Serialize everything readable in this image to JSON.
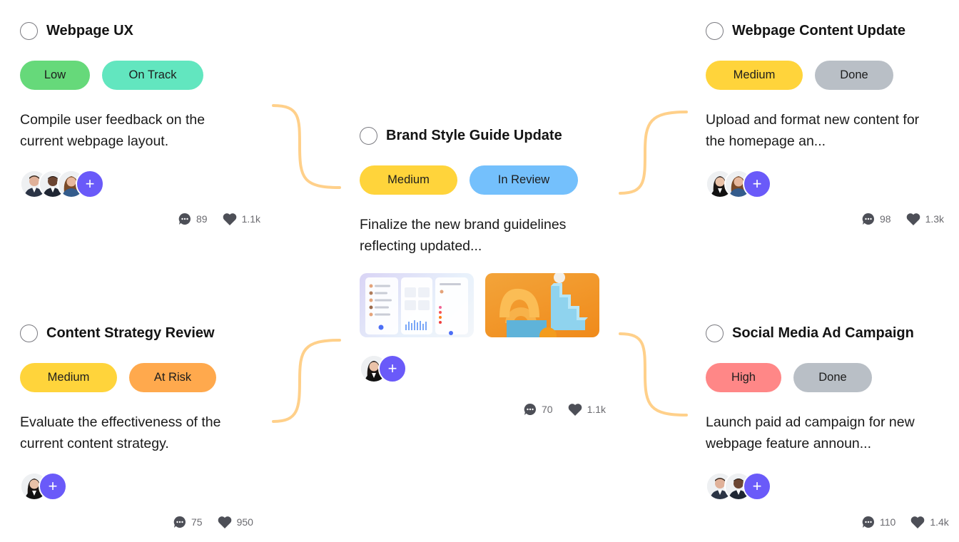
{
  "colors": {
    "low": "#66d97a",
    "on_track": "#62e6bf",
    "medium": "#ffd43b",
    "done": "#b9bfc6",
    "in_review": "#74c0fc",
    "at_risk": "#ffa94d",
    "high": "#ff8787",
    "plus": "#6a5af9",
    "connector": "#ffd08a"
  },
  "cards": [
    {
      "title": "Webpage UX",
      "tags": [
        "Low",
        "On Track"
      ],
      "description": "Compile user feedback on the current webpage layout.",
      "comments": "89",
      "likes": "1.1k",
      "add_label": "+"
    },
    {
      "title": "Webpage Content Update",
      "tags": [
        "Medium",
        "Done"
      ],
      "description": "Upload and format new content for the homepage an...",
      "comments": "98",
      "likes": "1.3k",
      "add_label": "+"
    },
    {
      "title": "Brand Style Guide Update",
      "tags": [
        "Medium",
        "In Review"
      ],
      "description": "Finalize the new brand guidelines reflecting updated...",
      "comments": "70",
      "likes": "1.1k",
      "add_label": "+"
    },
    {
      "title": "Content Strategy Review",
      "tags": [
        "Medium",
        "At Risk"
      ],
      "description": "Evaluate the effectiveness of the current content strategy.",
      "comments": "75",
      "likes": "950",
      "add_label": "+"
    },
    {
      "title": "Social Media Ad Campaign",
      "tags": [
        "High",
        "Done"
      ],
      "description": "Launch paid ad campaign for new webpage feature announ...",
      "comments": "110",
      "likes": "1.4k",
      "add_label": "+"
    }
  ]
}
